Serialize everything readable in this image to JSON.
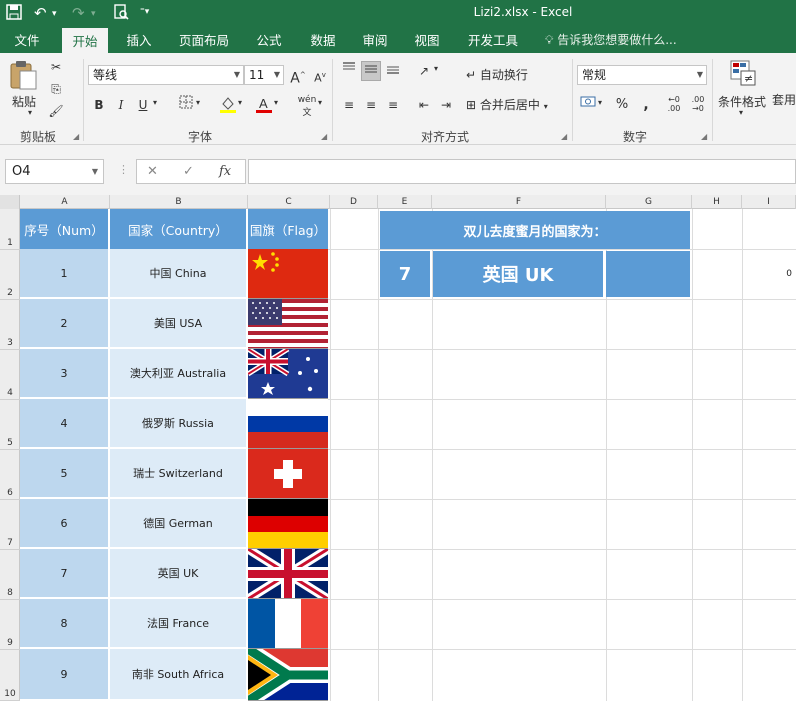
{
  "window": {
    "title": "Lizi2.xlsx - Excel"
  },
  "tabs": [
    "文件",
    "开始",
    "插入",
    "页面布局",
    "公式",
    "数据",
    "审阅",
    "视图",
    "开发工具"
  ],
  "active_tab": "开始",
  "tell_me": "告诉我您想要做什么...",
  "ribbon": {
    "paste_label": "粘贴",
    "clipboard_label": "剪贴板",
    "font_label": "字体",
    "font_name": "等线",
    "font_size": "11",
    "font_grow": "A",
    "font_shrink": "A",
    "bold": "B",
    "italic": "I",
    "underline": "U",
    "phonetic": "wén",
    "alignment_label": "对齐方式",
    "wrap_text": "自动换行",
    "merge_center": "合并后居中",
    "number_label": "数字",
    "number_format": "常规",
    "percent": "%",
    "comma": ",",
    "cond_format": "条件格式",
    "table_format": "套用表格格式"
  },
  "formula_bar": {
    "name_box": "O4",
    "cancel": "✕",
    "enter": "✓",
    "fx": "fx",
    "value": ""
  },
  "columns": [
    "A",
    "B",
    "C",
    "D",
    "E",
    "F",
    "G",
    "H",
    "I"
  ],
  "rows": [
    "1",
    "2",
    "3",
    "4",
    "5",
    "6",
    "7",
    "8",
    "9",
    "10"
  ],
  "table": {
    "headers": [
      "序号（Num）",
      "国家（Country）",
      "国旗（Flag）"
    ],
    "rows": [
      {
        "num": "1",
        "country": "中国 China",
        "flag": "china"
      },
      {
        "num": "2",
        "country": "美国 USA",
        "flag": "usa"
      },
      {
        "num": "3",
        "country": "澳大利亚 Australia",
        "flag": "australia"
      },
      {
        "num": "4",
        "country": "俄罗斯 Russia",
        "flag": "russia"
      },
      {
        "num": "5",
        "country": "瑞士 Switzerland",
        "flag": "switzerland"
      },
      {
        "num": "6",
        "country": "德国 German",
        "flag": "germany"
      },
      {
        "num": "7",
        "country": "英国 UK",
        "flag": "uk"
      },
      {
        "num": "8",
        "country": "法国 France",
        "flag": "france"
      },
      {
        "num": "9",
        "country": "南非 South Africa",
        "flag": "south-africa"
      }
    ]
  },
  "banner": "双儿去度蜜月的国家为：",
  "result": {
    "num": "7",
    "country": "英国 UK"
  },
  "i2_value": "0",
  "colors": {
    "excel_green": "#217346",
    "header_blue": "#5b9bd5",
    "light_blue": "#bdd7ee",
    "pale_blue": "#ddebf7"
  }
}
